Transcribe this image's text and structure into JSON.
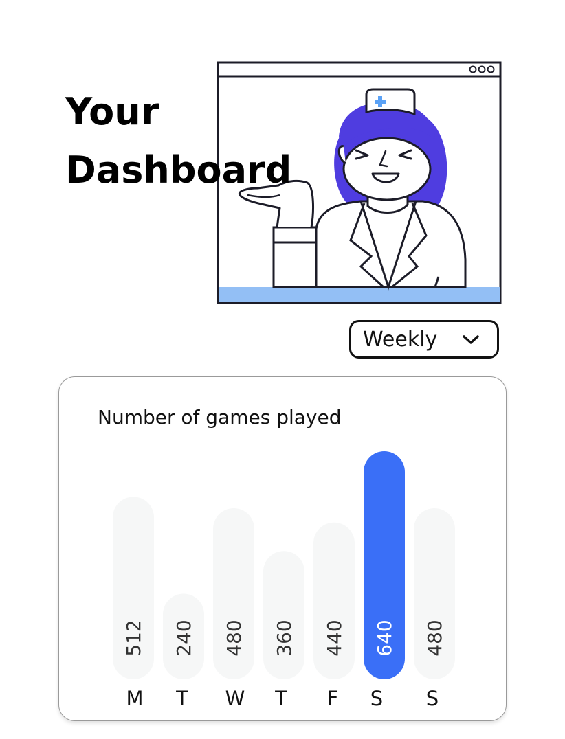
{
  "header": {
    "title_line1": "Your",
    "title_line2": "Dashboard"
  },
  "illustration": {
    "window_dots_icon": "three-dots-icon",
    "badge_icon": "medical-cross-icon"
  },
  "dropdown": {
    "selected": "Weekly",
    "icon": "chevron-down-icon"
  },
  "colors": {
    "accent": "#3a6ff7",
    "inactive_bar": "#f6f7f7",
    "hair": "#4f3de0",
    "desk": "#93bff5",
    "value_text_inactive": "#333333",
    "value_text_active": "#ffffff"
  },
  "chart_data": {
    "type": "bar",
    "title": "Number of games played",
    "xlabel": "",
    "ylabel": "",
    "categories": [
      "M",
      "T",
      "W",
      "T",
      "F",
      "S",
      "S"
    ],
    "values": [
      512,
      240,
      480,
      360,
      440,
      640,
      480
    ],
    "highlighted_index": 5,
    "ylim": [
      0,
      640
    ],
    "grid": false,
    "legend": "none"
  }
}
